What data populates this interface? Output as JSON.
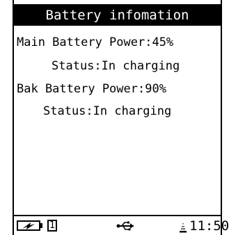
{
  "title": "Battery infomation",
  "main_battery": {
    "power_line": "Main Battery Power:45%",
    "status_line": "Status:In charging"
  },
  "bak_battery": {
    "power_line": "Bak Battery Power:90%",
    "status_line": "Status:In charging"
  },
  "statusbar": {
    "battery_icon": "battery-charging-icon",
    "indicator_number": "1",
    "usb_icon": "usb-icon",
    "signal_icon": "signal-icon",
    "time": "11:50"
  }
}
